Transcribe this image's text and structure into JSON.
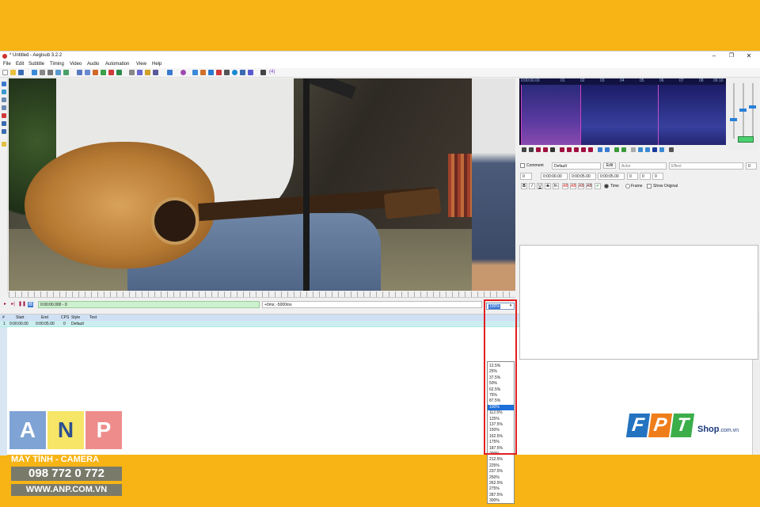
{
  "window": {
    "title": "* Untitled - Aegisub 3.2.2",
    "controls": [
      "–",
      "❐",
      "✕"
    ]
  },
  "menu": [
    "File",
    "Edit",
    "Subtitle",
    "Timing",
    "Video",
    "Audio",
    "Automation",
    "View",
    "Help"
  ],
  "toolbar": {
    "zoom_badge": "(4)"
  },
  "video_controls": {
    "time_value": "0:00:00.000 - 0",
    "offset_value": "+0ms; -5000ms",
    "zoom_selected": "100%"
  },
  "zoom_options": [
    "12.5%",
    "25%",
    "37.5%",
    "50%",
    "62.5%",
    "75%",
    "87.5%",
    "100%",
    "112.5%",
    "125%",
    "137.5%",
    "150%",
    "162.5%",
    "175%",
    "187.5%",
    "200%",
    "212.5%",
    "225%",
    "237.5%",
    "250%",
    "262.5%",
    "275%",
    "287.5%",
    "300%"
  ],
  "zoom_selected_index": 7,
  "grid": {
    "headers": [
      "#",
      "Start",
      "End",
      "CPS",
      "Style",
      "Text"
    ],
    "rows": [
      {
        "num": "1",
        "start": "0:00:00.00",
        "end": "0:00:05.00",
        "cps": "0",
        "style": "Default",
        "text": ""
      }
    ]
  },
  "audio": {
    "ruler": [
      "0:00:00.00",
      "01",
      "02",
      "03",
      "04",
      "05",
      "06",
      "07",
      "08",
      "09",
      "10"
    ]
  },
  "edit": {
    "comment_label": "Comment",
    "style_value": "Default",
    "edit_button": "Edit",
    "actor_placeholder": "Actor",
    "effect_placeholder": "Effect",
    "effect_number": "0",
    "layer": "0",
    "start_time": "0:00:00.00",
    "end_time": "0:00:05.00",
    "duration": "0:00:05.00",
    "margin_l": "0",
    "margin_r": "0",
    "margin_v": "0",
    "bold": "B",
    "italic": "I",
    "underline": "U",
    "strike": "S",
    "fn": "fn",
    "ab1": "AB",
    "ab2": "AB",
    "ab3": "AB",
    "ab4": "AB",
    "time_label": "Time",
    "frame_label": "Frame",
    "show_original_label": "Show Original"
  },
  "branding": {
    "anp_a": "A",
    "anp_n": "N",
    "anp_p": "P",
    "anp_tagline": "MÁY TÍNH - CAMERA",
    "anp_phone": "098 772 0 772",
    "anp_web": "WWW.ANP.COM.VN",
    "fpt_f": "F",
    "fpt_p": "P",
    "fpt_t": "T",
    "fpt_shop": "Shop",
    "fpt_domain": ".com.vn"
  },
  "colors": {
    "background": "#f7b414",
    "highlight": "#e02020",
    "selection": "#1e6fd9",
    "time_field": "#cdf0cf"
  }
}
